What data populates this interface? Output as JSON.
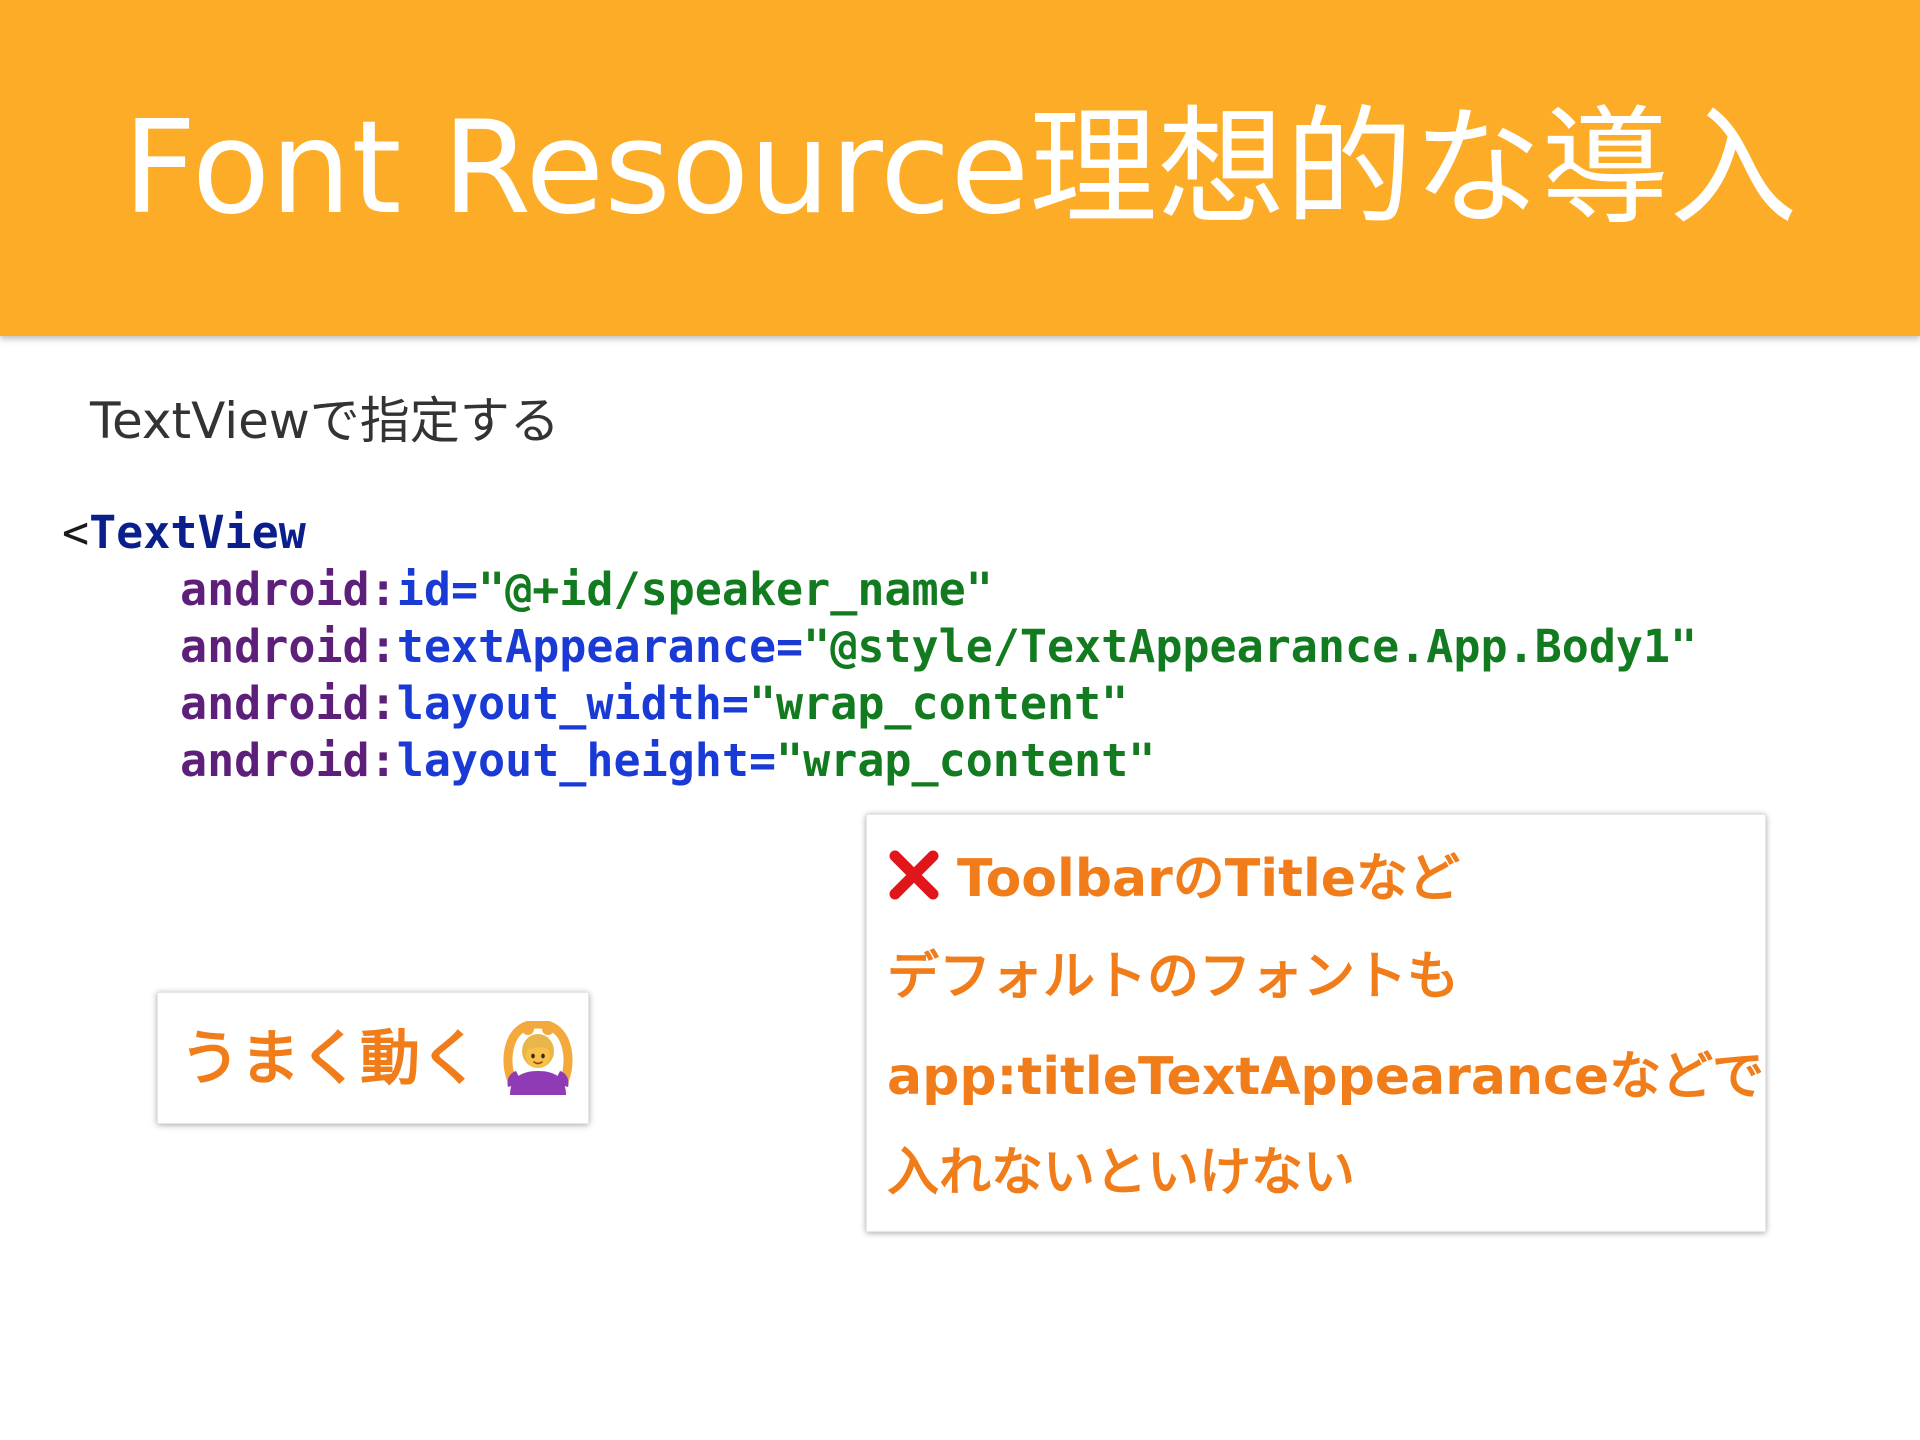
{
  "header": {
    "title": "Font Resource理想的な導入",
    "background_color": "#fcac26"
  },
  "subtitle": "TextViewで指定する",
  "code": {
    "open_bracket": "<",
    "tag": "TextView",
    "attributes": [
      {
        "ns": "android:",
        "name": "id",
        "eq": "=",
        "value": "\"@+id/speaker_name\""
      },
      {
        "ns": "android:",
        "name": "textAppearance",
        "eq": "=",
        "value": "\"@style/TextAppearance.App.Body1\""
      },
      {
        "ns": "android:",
        "name": "layout_width",
        "eq": "=",
        "value": "\"wrap_content\""
      },
      {
        "ns": "android:",
        "name": "layout_height",
        "eq": "=",
        "value": "\"wrap_content\""
      }
    ]
  },
  "card_left": {
    "label": "うまく動く",
    "icon": "person-gesturing-ok-icon"
  },
  "card_right": {
    "icon": "cross-mark-icon",
    "lines": [
      "ToolbarのTitleなど",
      "デフォルトのフォントも",
      "app:titleTextAppearanceなどで",
      "入れないといけない"
    ]
  },
  "colors": {
    "accent": "#f07d1a",
    "tag": "#0a1e8c",
    "namespace": "#5d1f7a",
    "attribute": "#1a3ad6",
    "value": "#127a1f",
    "cross": "#e0161b"
  }
}
